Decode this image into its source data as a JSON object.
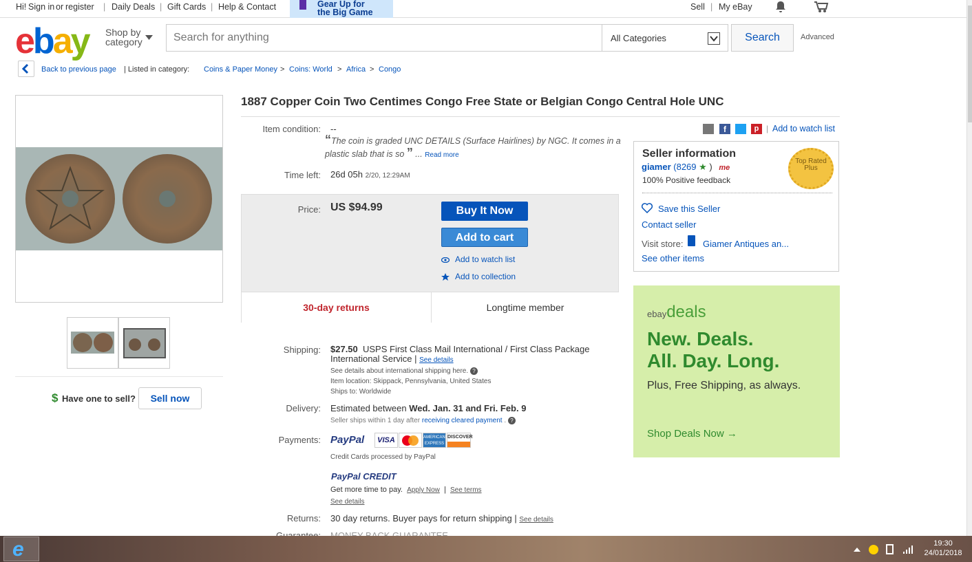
{
  "topbar": {
    "greeting_pre": "Hi!",
    "sign_in": "Sign in",
    "or": "or",
    "register": "register",
    "daily_deals": "Daily Deals",
    "gift_cards": "Gift Cards",
    "help": "Help & Contact",
    "promo_line1": "Gear Up for",
    "promo_line2": "the Big Game",
    "sell": "Sell",
    "my_ebay": "My eBay"
  },
  "header": {
    "logo": "ebay",
    "shop_by_line1": "Shop by",
    "shop_by_line2": "category",
    "search_placeholder": "Search for anything",
    "category_select": "All Categories",
    "search_button": "Search",
    "advanced": "Advanced"
  },
  "breadcrumb": {
    "back": "Back to previous page",
    "listed_in": "| Listed in category:",
    "items": [
      "Coins & Paper Money",
      "Coins: World",
      "Africa",
      "Congo"
    ]
  },
  "item": {
    "title": "1887 Copper Coin Two Centimes Congo Free State or Belgian Congo Central Hole UNC",
    "condition_label": "Item condition:",
    "condition_value": "--",
    "condition_quote": "The coin is graded UNC DETAILS (Surface Hairlines) by NGC. It comes in a plastic slab that is so",
    "read_more": "Read more",
    "time_left_label": "Time left:",
    "time_left": "26d 05h",
    "time_left_end": "2/20, 12:29AM",
    "price_label": "Price:",
    "price": "US $94.99",
    "buy_now": "Buy It Now",
    "add_cart": "Add to cart",
    "add_watch": "Add to watch list",
    "add_collection": "Add to collection",
    "returns_badge": "30-day returns",
    "member_badge": "Longtime member",
    "shipping_label": "Shipping:",
    "shipping_price": "$27.50",
    "shipping_desc": "USPS First Class Mail International / First Class Package International Service |",
    "see_details": "See details",
    "intl_note": "See details about international shipping here.",
    "item_location": "Item location:  Skippack, Pennsylvania, United States",
    "ships_to": "Ships to:  Worldwide",
    "delivery_label": "Delivery:",
    "delivery_pre": "Estimated between",
    "delivery_dates": "Wed. Jan. 31 and Fri. Feb. 9",
    "seller_ships": "Seller ships within 1 day after",
    "cleared_payment": "receiving cleared payment",
    "payments_label": "Payments:",
    "paypal": "PayPal",
    "cards": [
      "VISA",
      "MC",
      "AMEX",
      "DISCOVER"
    ],
    "credit_note": "Credit Cards processed by PayPal",
    "paypal_credit": "PayPal CREDIT",
    "more_time": "Get more time to pay.",
    "apply_now": "Apply Now",
    "see_terms": "See terms",
    "see_details2": "See details",
    "returns_label": "Returns:",
    "returns_text": "30 day returns. Buyer pays for return shipping |",
    "see_details3": "See details",
    "guarantee_label": "Guarantee:",
    "guarantee_text": "MONEY BACK GUARANTEE"
  },
  "left": {
    "have_one": "Have one to sell?",
    "sell_now": "Sell now"
  },
  "share": {
    "add_watch": "Add to watch list"
  },
  "seller": {
    "heading": "Seller information",
    "name": "giamer",
    "score": "(8269",
    "score_close": ")",
    "feedback": "100% Positive feedback",
    "badge": "Top Rated Plus",
    "save": "Save this Seller",
    "contact": "Contact seller",
    "visit_store": "Visit store:",
    "store_name": "Giamer Antiques an...",
    "other_items": "See other items"
  },
  "deals": {
    "brand": "ebay",
    "brand2": "deals",
    "line1": "New. Deals.",
    "line2": "All. Day. Long.",
    "sub": "Plus, Free Shipping, as always.",
    "cta": "Shop Deals Now →"
  },
  "taskbar": {
    "time": "19:30",
    "date": "24/01/2018"
  }
}
